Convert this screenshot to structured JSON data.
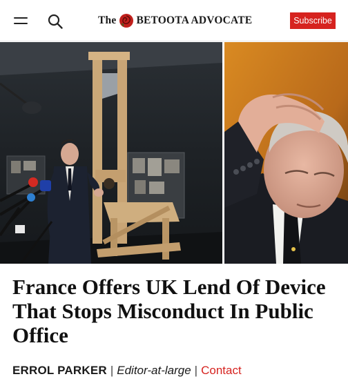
{
  "header": {
    "logo_prefix": "The",
    "logo_name": "BETOOTA ADVOCATE",
    "subscribe_label": "Subscribe",
    "accent_color": "#d6231f"
  },
  "icons": {
    "menu": "hamburger-menu-icon",
    "search": "search-icon",
    "logo_emblem": "rose-emblem-icon"
  },
  "article": {
    "headline": "France Offers UK Lend Of Device That Stops Misconduct In Public Office",
    "author": "ERROL PARKER",
    "separator": "|",
    "role": "Editor-at-large",
    "contact_label": "Contact"
  }
}
